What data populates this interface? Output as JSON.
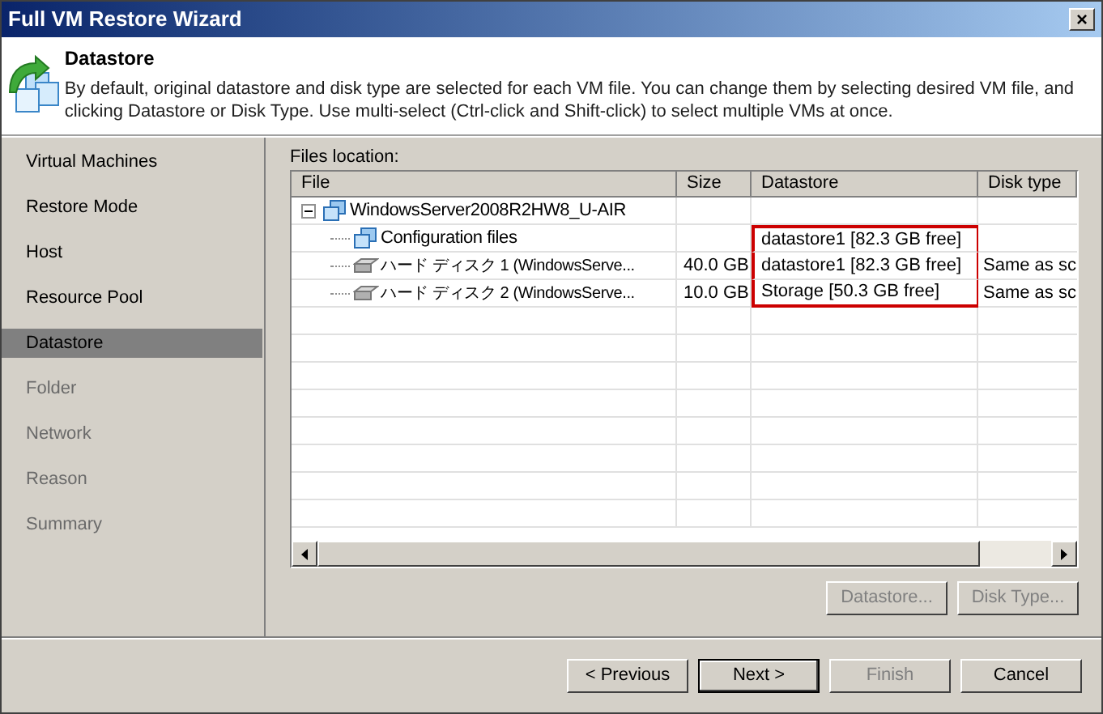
{
  "window": {
    "title": "Full VM Restore Wizard",
    "close": "×"
  },
  "header": {
    "title": "Datastore",
    "description": "By default, original datastore and disk type are selected for each VM file. You can change them by selecting desired VM file, and clicking Datastore or Disk Type. Use multi-select (Ctrl-click and Shift-click) to select multiple VMs at once."
  },
  "sidebar": {
    "items": [
      {
        "label": "Virtual Machines",
        "selected": false,
        "disabled": false
      },
      {
        "label": "Restore Mode",
        "selected": false,
        "disabled": false
      },
      {
        "label": "Host",
        "selected": false,
        "disabled": false
      },
      {
        "label": "Resource Pool",
        "selected": false,
        "disabled": false
      },
      {
        "label": "Datastore",
        "selected": true,
        "disabled": false
      },
      {
        "label": "Folder",
        "selected": false,
        "disabled": true
      },
      {
        "label": "Network",
        "selected": false,
        "disabled": true
      },
      {
        "label": "Reason",
        "selected": false,
        "disabled": true
      },
      {
        "label": "Summary",
        "selected": false,
        "disabled": true
      }
    ]
  },
  "files_location": {
    "label": "Files location:",
    "columns": [
      "File",
      "Size",
      "Datastore",
      "Disk type"
    ],
    "rows": [
      {
        "kind": "vm",
        "file": "WindowsServer2008R2HW8_U-AIR",
        "expanded": true,
        "highlighted": false,
        "children": [
          {
            "kind": "config",
            "file": "Configuration files",
            "datastore": "datastore1 [82.3 GB free]",
            "highlighted": true
          },
          {
            "kind": "disk",
            "file": "ハード ディスク 1 (WindowsServe...",
            "size": "40.0 GB",
            "datastore": "datastore1 [82.3 GB free]",
            "disk_type": "Same as sc",
            "highlighted": true
          },
          {
            "kind": "disk",
            "file": "ハード ディスク 2 (WindowsServe...",
            "size": "10.0 GB",
            "datastore": "Storage [50.3 GB free]",
            "disk_type": "Same as sc",
            "highlighted": true
          }
        ]
      }
    ],
    "buttons": [
      {
        "label": "Datastore...",
        "disabled": true
      },
      {
        "label": "Disk Type...",
        "disabled": true
      }
    ]
  },
  "footer": {
    "buttons": [
      {
        "label": "< Previous",
        "disabled": false,
        "default": false
      },
      {
        "label": "Next >",
        "disabled": false,
        "default": true
      },
      {
        "label": "Finish",
        "disabled": true,
        "default": false
      },
      {
        "label": "Cancel",
        "disabled": false,
        "default": false
      }
    ]
  }
}
